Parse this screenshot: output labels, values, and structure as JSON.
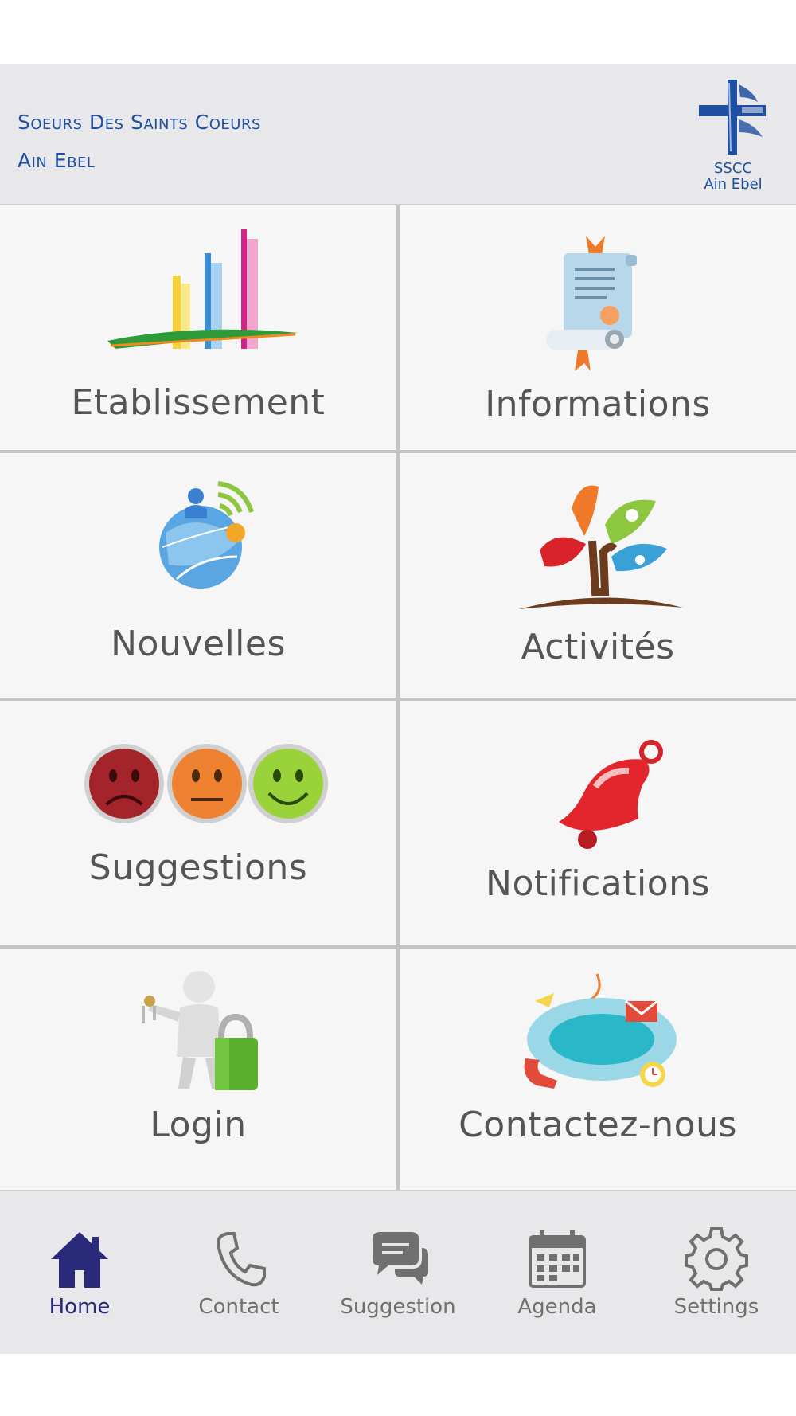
{
  "header": {
    "title_line1": "Soeurs Des Saints Coeurs",
    "title_line2": "Ain Ebel",
    "logo_line1": "SSCC",
    "logo_line2": "Ain Ebel",
    "brand_color": "#1f4fa0"
  },
  "tiles": [
    {
      "label": "Etablissement",
      "icon": "bars-chart-icon"
    },
    {
      "label": "Informations",
      "icon": "scroll-certificate-icon"
    },
    {
      "label": "Nouvelles",
      "icon": "globe-broadcast-icon"
    },
    {
      "label": "Activités",
      "icon": "activity-tree-icon"
    },
    {
      "label": "Suggestions",
      "icon": "smiley-faces-icon"
    },
    {
      "label": "Notifications",
      "icon": "bell-icon"
    },
    {
      "label": "Login",
      "icon": "user-lock-icon"
    },
    {
      "label": "Contactez-nous",
      "icon": "chat-bubble-contact-icon"
    }
  ],
  "bottom_nav": [
    {
      "label": "Home",
      "icon": "home-icon",
      "active": true
    },
    {
      "label": "Contact",
      "icon": "phone-icon",
      "active": false
    },
    {
      "label": "Suggestion",
      "icon": "chat-icon",
      "active": false
    },
    {
      "label": "Agenda",
      "icon": "calendar-icon",
      "active": false
    },
    {
      "label": "Settings",
      "icon": "gear-icon",
      "active": false
    }
  ],
  "colors": {
    "active_nav": "#2a2a7a",
    "inactive_nav": "#707070",
    "tile_bg": "#f6f6f6",
    "bar_bg": "#e8e8ea"
  }
}
